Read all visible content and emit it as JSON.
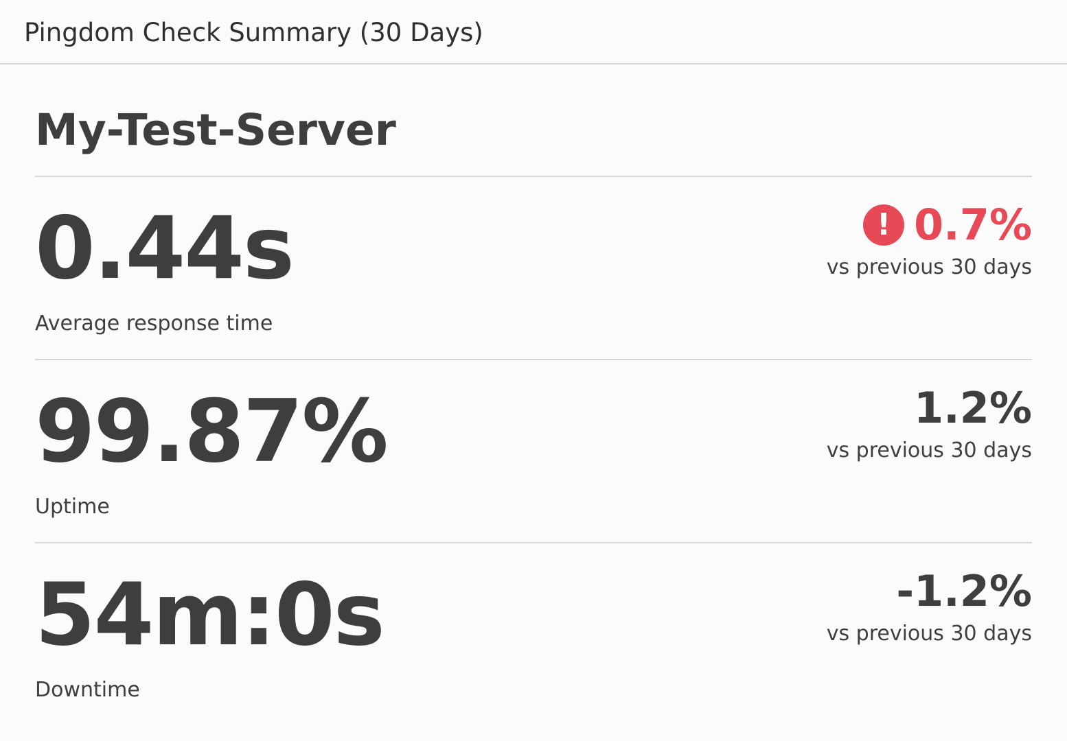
{
  "header": {
    "title": "Pingdom Check Summary (30 Days)"
  },
  "server": {
    "name": "My-Test-Server"
  },
  "metrics": [
    {
      "value": "0.44s",
      "label": "Average response time",
      "change": "0.7%",
      "caption": "vs previous 30 days",
      "alert": true,
      "icon": "exclamation-circle-icon",
      "icon_glyph": "!"
    },
    {
      "value": "99.87%",
      "label": "Uptime",
      "change": "1.2%",
      "caption": "vs previous 30 days",
      "alert": false
    },
    {
      "value": "54m:0s",
      "label": "Downtime",
      "change": "-1.2%",
      "caption": "vs previous 30 days",
      "alert": false
    }
  ],
  "colors": {
    "text": "#3e3e3e",
    "alert": "#e84956",
    "divider": "#d6d6d6",
    "background": "#fbfbfb"
  }
}
